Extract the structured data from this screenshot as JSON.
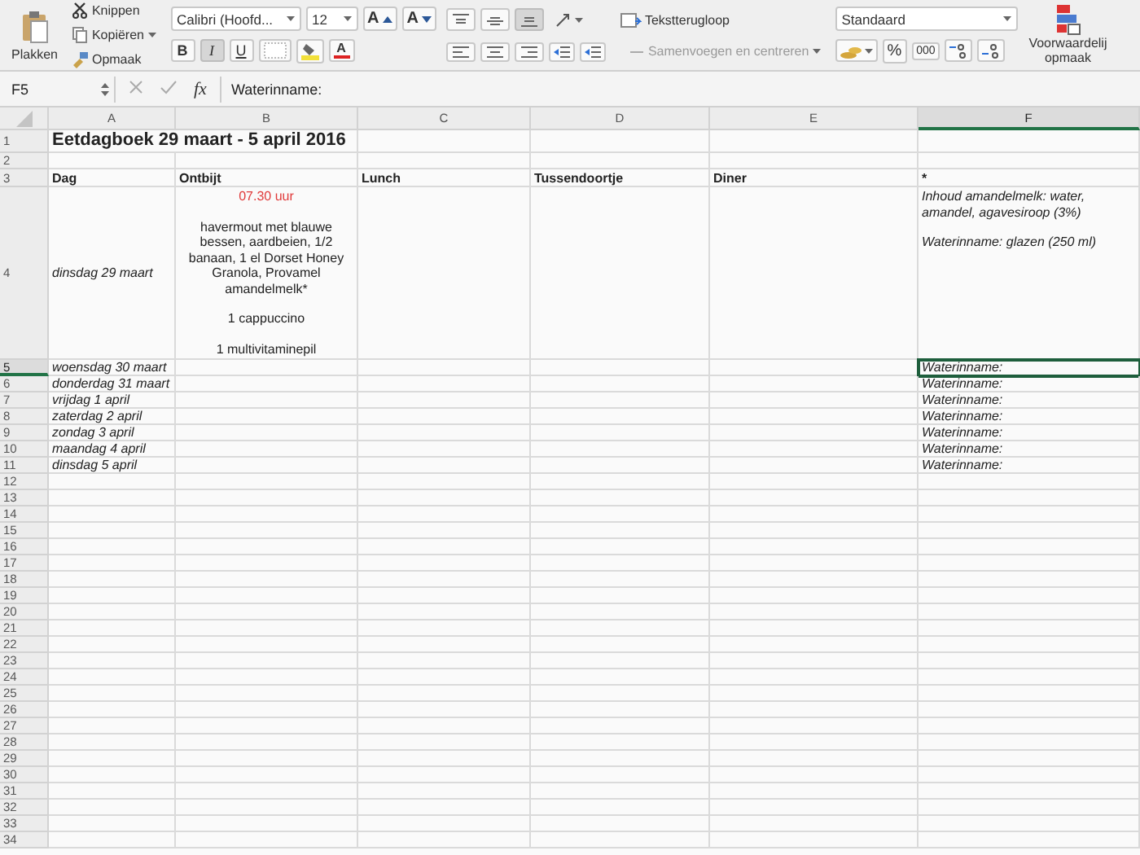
{
  "ribbon": {
    "clipboard": {
      "paste": "Plakken",
      "items": [
        {
          "label": "Knippen",
          "dropdown": false
        },
        {
          "label": "Kopiëren",
          "dropdown": true
        },
        {
          "label": "Opmaak",
          "dropdown": false
        }
      ]
    },
    "font": {
      "name": "Calibri (Hoofd...",
      "size": "12",
      "grow_label": "A",
      "shrink_label": "A",
      "style_buttons": [
        {
          "label": "B",
          "on": false
        },
        {
          "label": "I",
          "on": true
        },
        {
          "label": "U",
          "on": false
        }
      ],
      "font_color_label": "A"
    },
    "alignment": {
      "vertical_buttons": [
        {
          "selected": false
        },
        {
          "selected": false
        },
        {
          "selected": true
        }
      ],
      "wrap": "Tekstterugloop",
      "merge": {
        "label": "Samenvoegen en centreren",
        "disabled": true
      }
    },
    "number": {
      "format": "Standaard",
      "percent": "%",
      "thousands": "000"
    },
    "styles": {
      "conditional": "Voorwaardelij",
      "conditional_2": "opmaak"
    }
  },
  "formula_bar": {
    "name_box": "F5",
    "function_label": "fx",
    "formula": "Waterinname:"
  },
  "columns": [
    {
      "label": "A",
      "selected": false
    },
    {
      "label": "B",
      "selected": false
    },
    {
      "label": "C",
      "selected": false
    },
    {
      "label": "D",
      "selected": false
    },
    {
      "label": "E",
      "selected": false
    },
    {
      "label": "F",
      "selected": true
    }
  ],
  "rows": [
    {
      "number": "1",
      "selected": false,
      "cells": {
        "A": {
          "text": "Eetdagboek 29 maart - 5 april 2016",
          "bold": true,
          "italic": false,
          "centered": false,
          "selected": false
        }
      }
    },
    {
      "number": "2",
      "selected": false
    },
    {
      "number": "3",
      "selected": false,
      "cells": {
        "A": {
          "text": "Dag",
          "bold": true,
          "italic": false,
          "centered": false,
          "selected": false
        },
        "B": {
          "text": "Ontbijt",
          "bold": true,
          "italic": false,
          "centered": false,
          "selected": false
        },
        "C": {
          "text": "Lunch",
          "bold": true,
          "italic": false,
          "centered": false,
          "selected": false
        },
        "D": {
          "text": "Tussendoortje",
          "bold": true,
          "italic": false,
          "centered": false,
          "selected": false
        },
        "E": {
          "text": "Diner",
          "bold": true,
          "italic": false,
          "centered": false,
          "selected": false
        },
        "F": {
          "text": "*",
          "bold": true,
          "italic": false,
          "centered": false,
          "selected": false
        }
      }
    },
    {
      "number": "4",
      "selected": false,
      "cells": {
        "A": {
          "text": "dinsdag 29 maart",
          "bold": false,
          "italic": true,
          "centered": false,
          "selected": false
        },
        "B": {
          "paragraphs": [
            {
              "kind": "time",
              "text": "07.30 uur"
            },
            {
              "kind": "text",
              "text": "havermout met blauwe bessen, aardbeien, 1/2 banaan, 1 el Dorset Honey Granola, Provamel amandelmelk*"
            },
            {
              "kind": "text",
              "text": "1 cappuccino"
            },
            {
              "kind": "text",
              "text": "1 multivitaminepil"
            }
          ],
          "bold": false,
          "italic": false,
          "centered": true,
          "selected": false
        },
        "F": {
          "paragraphs": [
            {
              "kind": "text",
              "text": "Inhoud amandelmelk: water, amandel, agavesiroop (3%)"
            },
            {
              "kind": "text",
              "text": "Waterinname:  glazen (250 ml)"
            }
          ],
          "bold": false,
          "italic": true,
          "centered": false,
          "selected": false
        }
      }
    },
    {
      "number": "5",
      "selected": true,
      "cells": {
        "A": {
          "text": "woensdag 30 maart",
          "bold": false,
          "italic": true,
          "centered": false,
          "selected": false
        },
        "F": {
          "text": "Waterinname:",
          "bold": false,
          "italic": true,
          "centered": false,
          "selected": true
        }
      }
    },
    {
      "number": "6",
      "selected": false,
      "cells": {
        "A": {
          "text": "donderdag 31 maart",
          "bold": false,
          "italic": true,
          "centered": false,
          "selected": false
        },
        "F": {
          "text": "Waterinname:",
          "bold": false,
          "italic": true,
          "centered": false,
          "selected": false
        }
      }
    },
    {
      "number": "7",
      "selected": false,
      "cells": {
        "A": {
          "text": "vrijdag 1 april",
          "bold": false,
          "italic": true,
          "centered": false,
          "selected": false
        },
        "F": {
          "text": "Waterinname:",
          "bold": false,
          "italic": true,
          "centered": false,
          "selected": false
        }
      }
    },
    {
      "number": "8",
      "selected": false,
      "cells": {
        "A": {
          "text": "zaterdag 2 april",
          "bold": false,
          "italic": true,
          "centered": false,
          "selected": false
        },
        "F": {
          "text": "Waterinname:",
          "bold": false,
          "italic": true,
          "centered": false,
          "selected": false
        }
      }
    },
    {
      "number": "9",
      "selected": false,
      "cells": {
        "A": {
          "text": "zondag 3 april",
          "bold": false,
          "italic": true,
          "centered": false,
          "selected": false
        },
        "F": {
          "text": "Waterinname:",
          "bold": false,
          "italic": true,
          "centered": false,
          "selected": false
        }
      }
    },
    {
      "number": "10",
      "selected": false,
      "cells": {
        "A": {
          "text": "maandag 4 april",
          "bold": false,
          "italic": true,
          "centered": false,
          "selected": false
        },
        "F": {
          "text": "Waterinname:",
          "bold": false,
          "italic": true,
          "centered": false,
          "selected": false
        }
      }
    },
    {
      "number": "11",
      "selected": false,
      "cells": {
        "A": {
          "text": "dinsdag 5 april",
          "bold": false,
          "italic": true,
          "centered": false,
          "selected": false
        },
        "F": {
          "text": "Waterinname:",
          "bold": false,
          "italic": true,
          "centered": false,
          "selected": false
        }
      }
    },
    {
      "number": "12",
      "selected": false
    },
    {
      "number": "13",
      "selected": false
    },
    {
      "number": "14",
      "selected": false
    },
    {
      "number": "15",
      "selected": false
    },
    {
      "number": "16",
      "selected": false
    },
    {
      "number": "17",
      "selected": false
    },
    {
      "number": "18",
      "selected": false
    },
    {
      "number": "19",
      "selected": false
    },
    {
      "number": "20",
      "selected": false
    },
    {
      "number": "21",
      "selected": false
    },
    {
      "number": "22",
      "selected": false
    },
    {
      "number": "23",
      "selected": false
    },
    {
      "number": "24",
      "selected": false
    },
    {
      "number": "25",
      "selected": false
    },
    {
      "number": "26",
      "selected": false
    },
    {
      "number": "27",
      "selected": false
    },
    {
      "number": "28",
      "selected": false
    },
    {
      "number": "29",
      "selected": false
    },
    {
      "number": "30",
      "selected": false
    },
    {
      "number": "31",
      "selected": false
    },
    {
      "number": "32",
      "selected": false
    },
    {
      "number": "33",
      "selected": false
    },
    {
      "number": "34",
      "selected": false
    }
  ]
}
